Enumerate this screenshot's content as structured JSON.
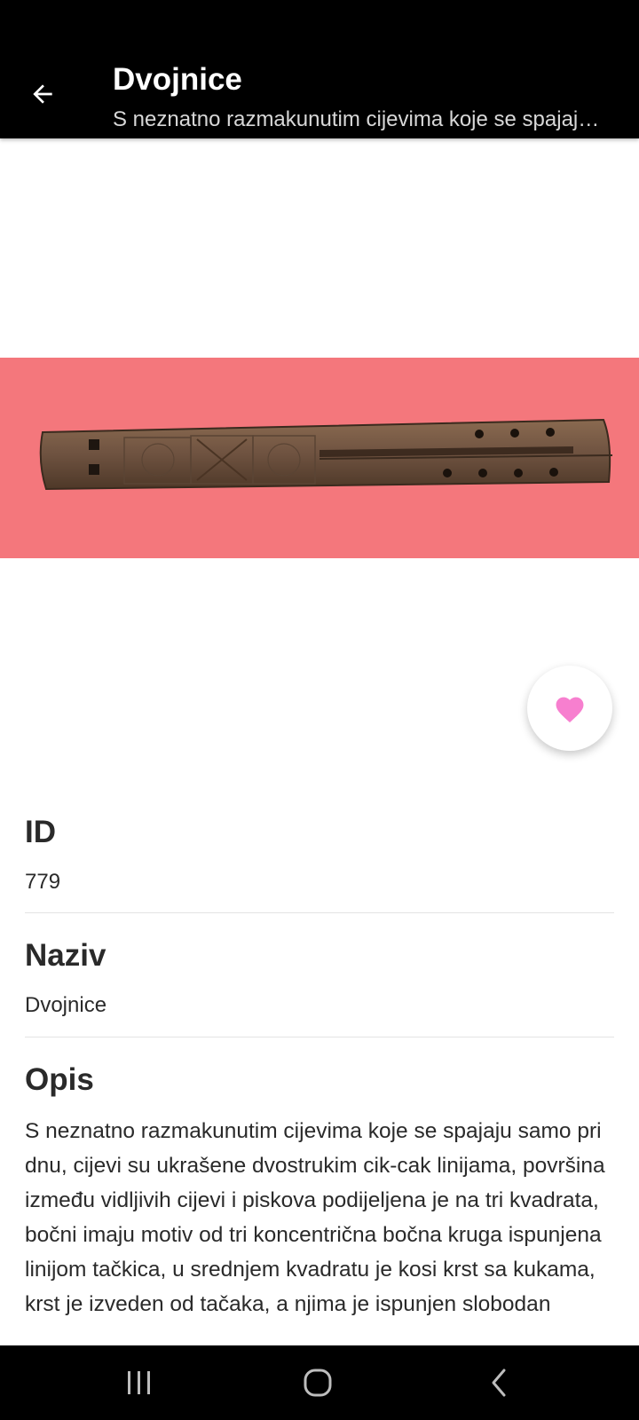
{
  "appbar": {
    "title": "Dvojnice",
    "subtitle": "S neznatno razmakunutim cijevima koje se spajaju samo pri dnu, cijevi su ukrašene dvostrukim cik-cak linijama"
  },
  "hero": {
    "background_color": "#f4777c",
    "icon": "double-flute-image"
  },
  "favorite": {
    "icon": "heart-icon",
    "color": "#f77fcf"
  },
  "fields": {
    "id": {
      "label": "ID",
      "value": "779"
    },
    "name": {
      "label": "Naziv",
      "value": "Dvojnice"
    },
    "description": {
      "label": "Opis",
      "value": "S neznatno razmakunutim cijevima koje se spajaju samo pri dnu, cijevi su ukrašene dvostrukim cik-cak linijama, površina između vidljivih cijevi i piskova podijeljena je na tri kvadrata, bočni imaju motiv od tri koncentrična bočna kruga ispunjena linijom tačkica, u srednjem kvadratu je kosi krst sa kukama, krst je izveden od tačaka, a njima je ispunjen slobodan"
    }
  },
  "navbar": {
    "icons": [
      "recent-apps-icon",
      "home-icon",
      "back-icon"
    ]
  }
}
